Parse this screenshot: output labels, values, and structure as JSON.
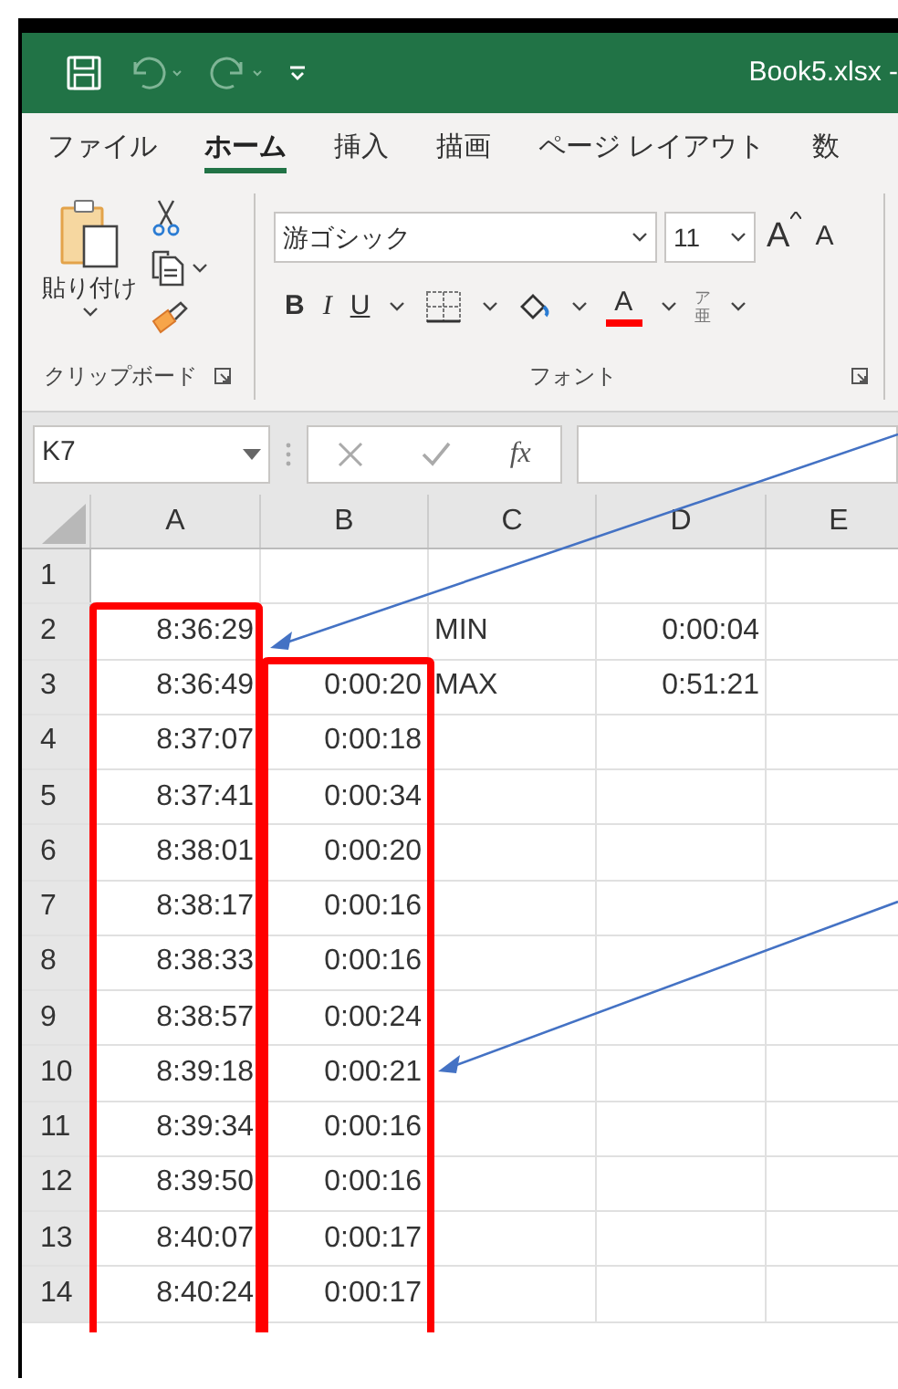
{
  "window": {
    "title": "Book5.xlsx -"
  },
  "ribbon_tabs": [
    {
      "label": "ファイル",
      "selected": false
    },
    {
      "label": "ホーム",
      "selected": true
    },
    {
      "label": "挿入",
      "selected": false
    },
    {
      "label": "描画",
      "selected": false
    },
    {
      "label": "ページ レイアウト",
      "selected": false
    },
    {
      "label": "数",
      "selected": false
    }
  ],
  "clipboard_group": {
    "paste_label": "貼り付け",
    "caption": "クリップボード"
  },
  "font_group": {
    "font_name": "游ゴシック",
    "font_size": "11",
    "bold": "B",
    "italic": "I",
    "underline": "U",
    "font_color_letter": "A",
    "grow_letter": "A",
    "shrink_letter": "A",
    "phonetic_top": "ア",
    "phonetic_bottom": "亜",
    "caption": "フォント"
  },
  "formula_bar": {
    "name_box": "K7",
    "function_label": "fx"
  },
  "columns": [
    "A",
    "B",
    "C",
    "D",
    "E"
  ],
  "rows": [
    {
      "header": "1",
      "cells": [
        "",
        "",
        "",
        "",
        ""
      ]
    },
    {
      "header": "2",
      "cells": [
        "8:36:29",
        "",
        "MIN",
        "0:00:04",
        ""
      ]
    },
    {
      "header": "3",
      "cells": [
        "8:36:49",
        "0:00:20",
        "MAX",
        "0:51:21",
        ""
      ]
    },
    {
      "header": "4",
      "cells": [
        "8:37:07",
        "0:00:18",
        "",
        "",
        ""
      ]
    },
    {
      "header": "5",
      "cells": [
        "8:37:41",
        "0:00:34",
        "",
        "",
        ""
      ]
    },
    {
      "header": "6",
      "cells": [
        "8:38:01",
        "0:00:20",
        "",
        "",
        ""
      ]
    },
    {
      "header": "7",
      "cells": [
        "8:38:17",
        "0:00:16",
        "",
        "",
        ""
      ]
    },
    {
      "header": "8",
      "cells": [
        "8:38:33",
        "0:00:16",
        "",
        "",
        ""
      ]
    },
    {
      "header": "9",
      "cells": [
        "8:38:57",
        "0:00:24",
        "",
        "",
        ""
      ]
    },
    {
      "header": "10",
      "cells": [
        "8:39:18",
        "0:00:21",
        "",
        "",
        ""
      ]
    },
    {
      "header": "11",
      "cells": [
        "8:39:34",
        "0:00:16",
        "",
        "",
        ""
      ]
    },
    {
      "header": "12",
      "cells": [
        "8:39:50",
        "0:00:16",
        "",
        "",
        ""
      ]
    },
    {
      "header": "13",
      "cells": [
        "8:40:07",
        "0:00:17",
        "",
        "",
        ""
      ]
    },
    {
      "header": "14",
      "cells": [
        "8:40:24",
        "0:00:17",
        "",
        "",
        ""
      ]
    }
  ]
}
